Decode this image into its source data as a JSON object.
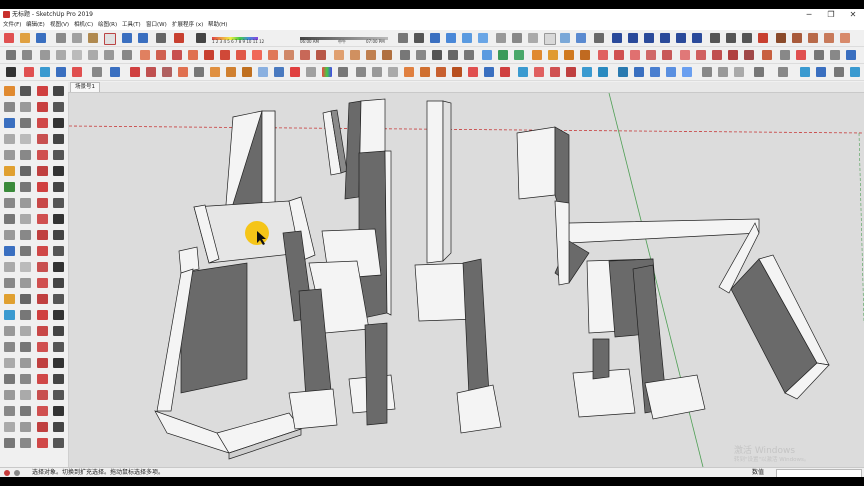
{
  "window": {
    "title": "无标题 - SketchUp Pro 2019",
    "minimize_glyph": "─",
    "restore_glyph": "❐",
    "close_glyph": "✕"
  },
  "menu": [
    "文件(F)",
    "编辑(E)",
    "视图(V)",
    "相机(C)",
    "绘图(R)",
    "工具(T)",
    "窗口(W)",
    "扩展程序 (x)",
    "帮助(H)"
  ],
  "shadow_time": {
    "months": "1 2 3 4 5 6 7 8 9 10 11 12",
    "start": "06:00 AM",
    "mid": "中午",
    "end": "07:00 PM"
  },
  "scene_tab": "场景号1",
  "status": {
    "hint": "选择对象。切换到扩充选择。拖动鼠标选择多项。",
    "measurements_label": "数值",
    "measurements_value": ""
  },
  "watermark": {
    "line1": "激活 Windows",
    "line2": "转到\"设置\"以激活 Windows。"
  },
  "accent_colors": {
    "axis_red": "#c63b3b",
    "axis_green": "#4f9f55",
    "wall_top": "#f4f4f4",
    "wall_shadow": "#6a6a6a",
    "cursor_highlight": "#f5c518"
  }
}
